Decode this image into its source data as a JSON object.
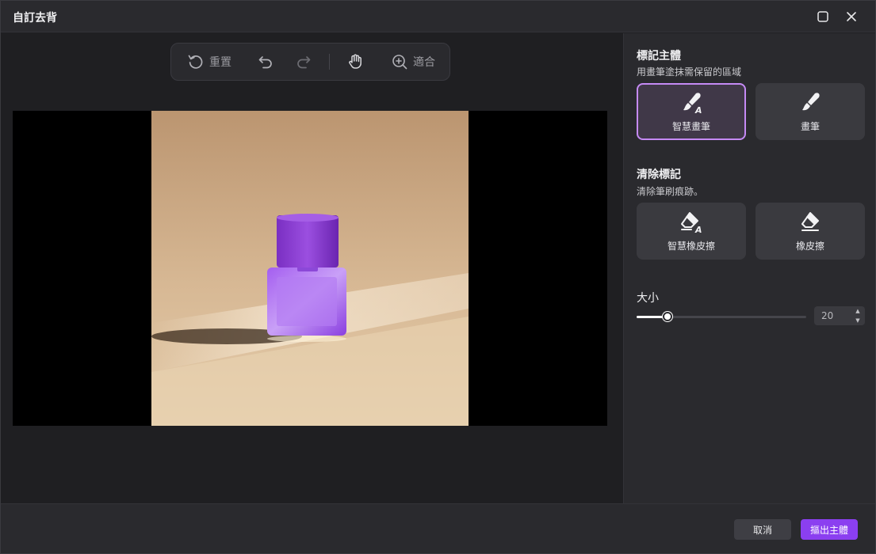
{
  "window": {
    "title": "自訂去背"
  },
  "toolbar": {
    "reset_label": "重置",
    "fit_label": "適合"
  },
  "panel": {
    "mark": {
      "title": "標記主體",
      "desc": "用畫筆塗抹需保留的區域",
      "tools": [
        {
          "label": "智慧畫筆",
          "icon": "smart-brush-icon",
          "active": true
        },
        {
          "label": "畫筆",
          "icon": "brush-icon",
          "active": false
        }
      ]
    },
    "clear": {
      "title": "清除標記",
      "desc": "清除筆刷痕跡。",
      "tools": [
        {
          "label": "智慧橡皮擦",
          "icon": "smart-eraser-icon"
        },
        {
          "label": "橡皮擦",
          "icon": "eraser-icon"
        }
      ]
    },
    "size": {
      "label": "大小",
      "value": "20",
      "slider_fraction": 0.18
    }
  },
  "footer": {
    "cancel_label": "取消",
    "confirm_label": "摳出主體"
  },
  "colors": {
    "accent": "#8b3ff0",
    "active_border": "#c58af5",
    "panel_bg": "#2a2a2e"
  }
}
